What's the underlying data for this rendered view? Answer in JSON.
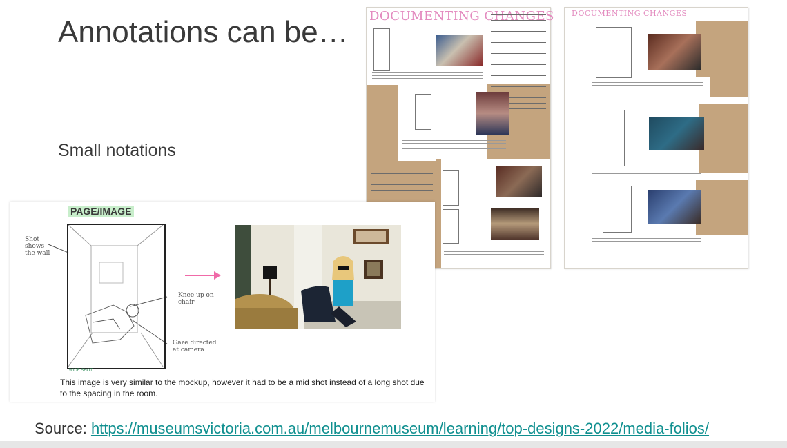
{
  "slide": {
    "title": "Annotations can be…",
    "subtitle": "Small notations",
    "source_prefix": "Source: ",
    "source_link": "https://museumsvictoria.com.au/melbournemuseum/learning/top-designs-2022/media-folios/"
  },
  "folio_1": {
    "heading": "DOCUMENTING CHANGES"
  },
  "folio_2": {
    "heading": "DOCUMENTING CHANGES"
  },
  "zoom": {
    "label": "PAGE/IMAGE",
    "notes": {
      "shot": "Shot\nshows\nthe wall",
      "knee": "Knee up on\nchair",
      "gaze": "Gaze directed\nat camera",
      "shot_type": "WIDE SHOT"
    },
    "caption": "This image is very similar to the mockup, however it had to be a mid shot instead of a long shot due to the spacing in the room."
  },
  "colors": {
    "title": "#3a3a3a",
    "link": "#0f8f8f",
    "kraft": "#c4a47e",
    "heading_pink": "#e38bbf",
    "label_green": "#c8eecb",
    "arrow_pink": "#f06aa8"
  }
}
